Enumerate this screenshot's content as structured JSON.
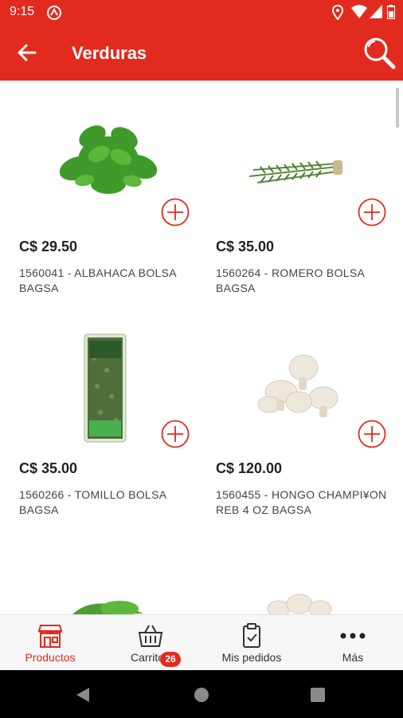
{
  "status_bar": {
    "time": "9:15"
  },
  "app_bar": {
    "title": "Verduras"
  },
  "colors": {
    "brand": "#e32a1f",
    "nav_active": "#e32a1f"
  },
  "products": [
    {
      "price": "C$ 29.50",
      "name": "1560041 - ALBAHACA BOLSA BAGSA",
      "icon": "basil-image"
    },
    {
      "price": "C$ 35.00",
      "name": "1560264 - ROMERO BOLSA BAGSA",
      "icon": "rosemary-image"
    },
    {
      "price": "C$ 35.00",
      "name": "1560266 - TOMILLO BOLSA BAGSA",
      "icon": "thyme-image"
    },
    {
      "price": "C$ 120.00",
      "name": "1560455 - HONGO CHAMPI¥ON REB 4 OZ BAGSA",
      "icon": "mushroom-image"
    }
  ],
  "bottom_nav": [
    {
      "label": "Productos",
      "icon": "store-icon",
      "active": true
    },
    {
      "label": "Carrito",
      "icon": "basket-icon",
      "badge": "26"
    },
    {
      "label": "Mis pedidos",
      "icon": "orders-icon"
    },
    {
      "label": "Más",
      "icon": "more-icon"
    }
  ]
}
